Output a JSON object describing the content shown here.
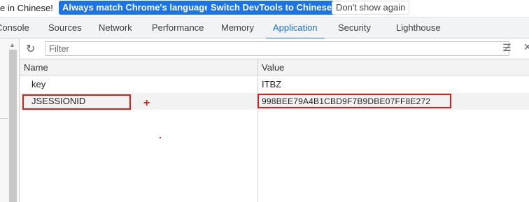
{
  "infobar": {
    "message": "e in Chinese!",
    "primary_button_1": "Always match Chrome's language",
    "primary_button_2": "Switch DevTools to Chinese",
    "secondary_button": "Don't show again"
  },
  "tabs": [
    {
      "label": "Console"
    },
    {
      "label": "Sources"
    },
    {
      "label": "Network"
    },
    {
      "label": "Performance"
    },
    {
      "label": "Memory"
    },
    {
      "label": "Application",
      "active": true
    },
    {
      "label": "Security"
    },
    {
      "label": "Lighthouse"
    }
  ],
  "toolbar": {
    "filter_placeholder": "Filter",
    "refresh_icon": "refresh-icon",
    "clear_icon": "clear-filter-icon",
    "close_icon": "close-icon"
  },
  "table": {
    "headers": {
      "name": "Name",
      "value": "Value"
    },
    "rows": [
      {
        "name": "key",
        "value": "ITBZ"
      },
      {
        "name": "JSESSIONID",
        "value": "998BEE79A4B1CBD9F7B9DBE07FF8E272"
      }
    ]
  },
  "annotation": {
    "plus": "+"
  },
  "colors": {
    "accent": "#1a73e8",
    "highlight": "#e01919"
  }
}
